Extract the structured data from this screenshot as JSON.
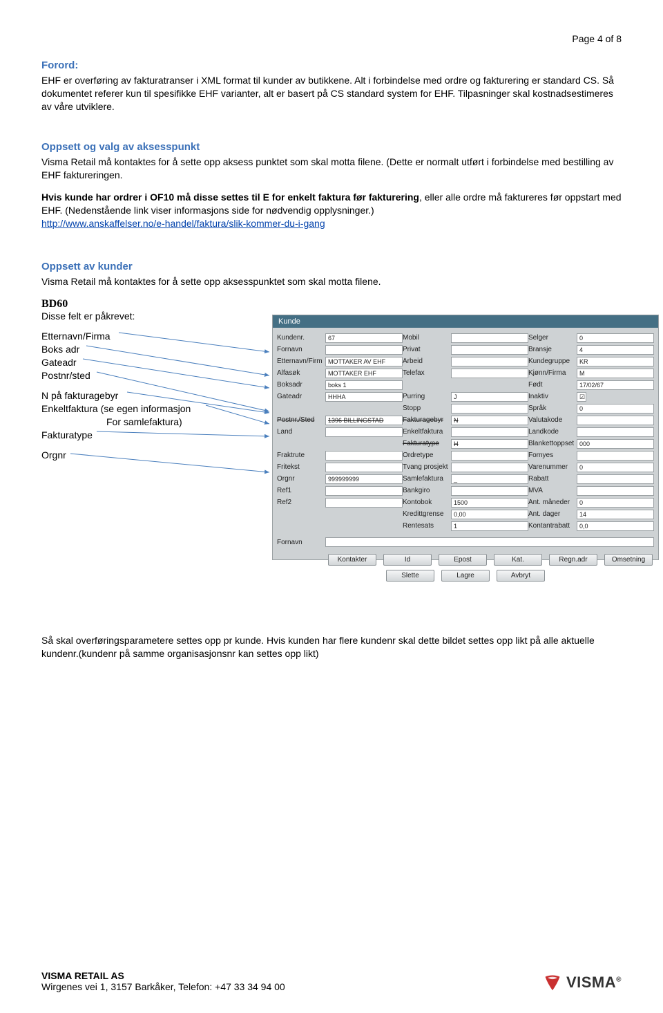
{
  "page_number": "Page 4 of 8",
  "forord": {
    "title": "Forord:",
    "p1": "EHF er overføring av fakturatranser i XML format til kunder av butikkene. Alt i forbindelse med ordre og fakturering er standard CS. Så dokumentet referer kun til spesifikke EHF varianter, alt er basert på CS standard system for EHF. Tilpasninger skal kostnadsestimeres av våre utviklere."
  },
  "oppsett_aksess": {
    "title": "Oppsett og valg av aksesspunkt",
    "p1": "Visma Retail må kontaktes for å sette opp aksess punktet som skal motta filene. (Dette er normalt utført i forbindelse med bestilling av EHF faktureringen.",
    "p2_bold": "Hvis kunde har ordrer i OF10 må disse settes til E for enkelt faktura før fakturering",
    "p2_rest": ", eller alle ordre må faktureres før oppstart med EHF. (Nedenstående link viser informasjons side for nødvendig opplysninger.)",
    "link": "http://www.anskaffelser.no/e-handel/faktura/slik-kommer-du-i-gang"
  },
  "oppsett_kunder": {
    "title": "Oppsett av kunder",
    "p1": "Visma Retail må kontaktes for å sette opp aksesspunktet som skal motta filene.",
    "bd60": "BD60",
    "sub": "Disse felt er påkrevet:",
    "fields": {
      "f1": "Etternavn/Firma",
      "f2": "Boks adr",
      "f3": "Gateadr",
      "f4": "Postnr/sted",
      "f5": "N på fakturagebyr",
      "f6a": "Enkeltfaktura (se egen informasjon",
      "f6b": "For samlefaktura)",
      "f7": "Fakturatype",
      "f8": "Orgnr"
    }
  },
  "kunde_form": {
    "title": "Kunde",
    "col1": [
      {
        "label": "Kundenr.",
        "value": "67"
      },
      {
        "label": "Fornavn",
        "value": ""
      },
      {
        "label": "Etternavn/Firma",
        "value": "MOTTAKER AV EHF"
      },
      {
        "label": "Alfasøk",
        "value": "MOTTAKER EHF"
      },
      {
        "label": "Boksadr",
        "value": "boks 1"
      },
      {
        "label": "Gateadr",
        "value": "HHHA"
      },
      {
        "label": "",
        "value": ""
      },
      {
        "label": "Postnr./Sted",
        "value": "1396   BILLINGSTAD",
        "strike": true
      },
      {
        "label": "Land",
        "value": ""
      },
      {
        "label": "",
        "value": ""
      },
      {
        "label": "Fraktrute",
        "value": ""
      },
      {
        "label": "Fritekst",
        "value": ""
      },
      {
        "label": "Orgnr",
        "value": "999999999"
      },
      {
        "label": "Ref1",
        "value": ""
      },
      {
        "label": "Ref2",
        "value": ""
      }
    ],
    "col2": [
      {
        "label": "Mobil",
        "value": ""
      },
      {
        "label": "Privat",
        "value": ""
      },
      {
        "label": "Arbeid",
        "value": ""
      },
      {
        "label": "Telefax",
        "value": ""
      },
      {
        "label": "",
        "value": ""
      },
      {
        "label": "Purring",
        "value": "J"
      },
      {
        "label": "Stopp",
        "value": ""
      },
      {
        "label": "Fakturagebyr",
        "value": "N",
        "strike": true
      },
      {
        "label": "Enkeltfaktura",
        "value": ""
      },
      {
        "label": "Fakturatype",
        "value": "H",
        "strike": true
      },
      {
        "label": "Ordretype",
        "value": ""
      },
      {
        "label": "Tvang prosjekt",
        "value": ""
      },
      {
        "label": "Samlefaktura",
        "value": "_"
      },
      {
        "label": "Bankgiro",
        "value": ""
      },
      {
        "label": "Kontobok",
        "value": "1500"
      },
      {
        "label": "Kredittgrense",
        "value": "0,00"
      },
      {
        "label": "Rentesats",
        "value": "1"
      }
    ],
    "col3": [
      {
        "label": "Selger",
        "value": "0"
      },
      {
        "label": "Bransje",
        "value": "4"
      },
      {
        "label": "Kundegruppe",
        "value": "KR"
      },
      {
        "label": "Kjønn/Firma",
        "value": "M"
      },
      {
        "label": "Født",
        "value": "17/02/67"
      },
      {
        "label": "Inaktiv",
        "value": "☑",
        "chk": true
      },
      {
        "label": "Språk",
        "value": "0"
      },
      {
        "label": "Valutakode",
        "value": ""
      },
      {
        "label": "Landkode",
        "value": ""
      },
      {
        "label": "Blankettoppsett",
        "value": "000"
      },
      {
        "label": "Fornyes",
        "value": ""
      },
      {
        "label": "Varenummer",
        "value": "0"
      },
      {
        "label": "Rabatt",
        "value": ""
      },
      {
        "label": "MVA",
        "value": ""
      },
      {
        "label": "Ant. måneder",
        "value": "0"
      },
      {
        "label": "Ant. dager",
        "value": "14"
      },
      {
        "label": "Kontantrabatt",
        "value": "0,0"
      }
    ],
    "bottom_label": "Fornavn",
    "buttons_row1": [
      "Kontakter",
      "Id",
      "Epost",
      "Kat.",
      "Regn.adr",
      "Omsetning"
    ],
    "buttons_row2": [
      "Slette",
      "Lagre",
      "Avbryt"
    ]
  },
  "bottom_text": "Så skal overføringsparametere settes opp pr kunde. Hvis kunden har flere kundenr skal dette bildet settes opp likt på alle aktuelle kundenr.(kundenr på samme organisasjonsnr kan settes opp likt)",
  "footer": {
    "company": "VISMA RETAIL AS",
    "address": "Wirgenes vei 1, 3157 Barkåker, Telefon: +47 33 34 94 00",
    "logo_text": "VISMA"
  }
}
